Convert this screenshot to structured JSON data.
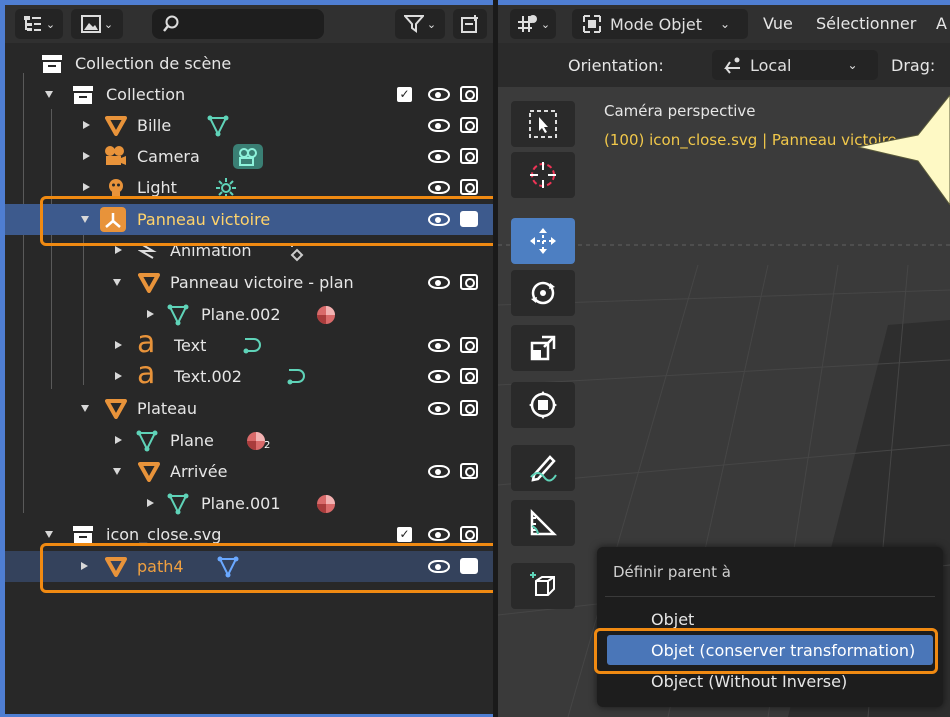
{
  "outliner": {
    "items": [
      {
        "label": "Collection de scène"
      },
      {
        "label": "Collection"
      },
      {
        "label": "Bille"
      },
      {
        "label": "Camera"
      },
      {
        "label": "Light"
      },
      {
        "label": "Panneau victoire"
      },
      {
        "label": "Animation"
      },
      {
        "label": "Panneau victoire - plan"
      },
      {
        "label": "Plane.002"
      },
      {
        "label": "Text"
      },
      {
        "label": "Text.002"
      },
      {
        "label": "Plateau"
      },
      {
        "label": "Plane"
      },
      {
        "label": "Arrivée"
      },
      {
        "label": "Plane.001"
      },
      {
        "label": "icon_close.svg"
      },
      {
        "label": "path4"
      }
    ],
    "plane_badge": "2"
  },
  "viewport": {
    "mode_label": "Mode Objet",
    "menu_view": "Vue",
    "menu_select": "Sélectionner",
    "menu_truncated": "A",
    "orientation_label": "Orientation:",
    "orientation_value": "Local",
    "drag_label": "Drag:",
    "camera_title": "Caméra perspective",
    "camera_info": "(100) icon_close.svg | Panneau victoire"
  },
  "context_menu": {
    "title": "Définir parent à",
    "items": [
      {
        "label": "Objet"
      },
      {
        "label": "Objet (conserver transformation)"
      },
      {
        "label": "Object (Without Inverse)"
      }
    ]
  },
  "colors": {
    "highlight": "#f08a12",
    "selection": "#3d5a8d",
    "mesh_orange": "#e8933a",
    "mesh_data_teal": "#5fd3b8"
  }
}
